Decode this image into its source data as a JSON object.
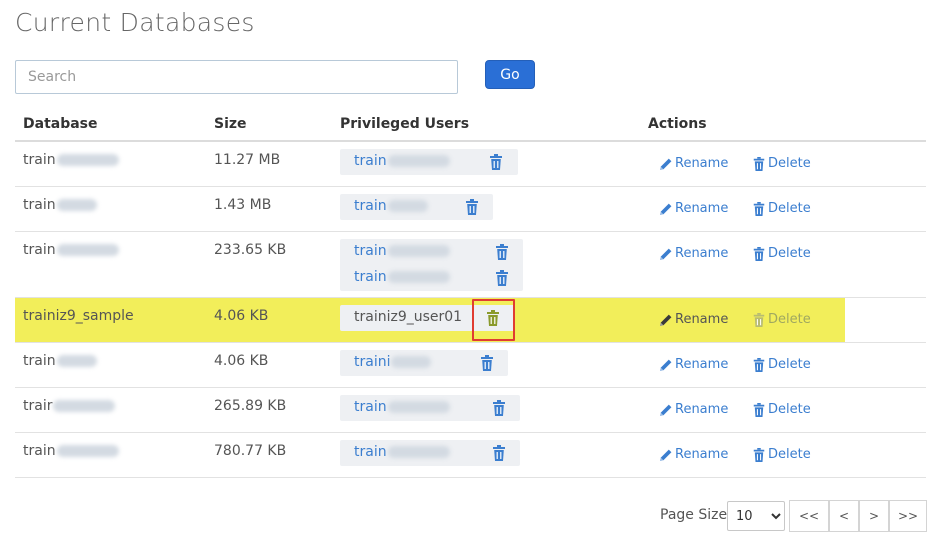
{
  "page": {
    "title": "Current Databases"
  },
  "search": {
    "placeholder": "Search",
    "value": "",
    "go_label": "Go"
  },
  "columns": {
    "database": "Database",
    "size": "Size",
    "users": "Privileged Users",
    "actions": "Actions"
  },
  "actions": {
    "rename_label": "Rename",
    "delete_label": "Delete"
  },
  "rows": [
    {
      "db_prefix": "train",
      "size": "11.27 MB",
      "users": [
        {
          "prefix": "train"
        }
      ]
    },
    {
      "db_prefix": "train",
      "size": "1.43 MB",
      "users": [
        {
          "prefix": "train"
        }
      ]
    },
    {
      "db_prefix": "train",
      "size": "233.65 KB",
      "users": [
        {
          "prefix": "train"
        },
        {
          "prefix": "train"
        }
      ]
    },
    {
      "db_name": "trainiz9_sample",
      "size": "4.06 KB",
      "highlighted": true,
      "delete_disabled": true,
      "users": [
        {
          "name": "trainiz9_user01"
        }
      ]
    },
    {
      "db_prefix": "train",
      "size": "4.06 KB",
      "users": [
        {
          "prefix": "traini"
        }
      ]
    },
    {
      "db_prefix": "trair",
      "size": "265.89 KB",
      "users": [
        {
          "prefix": "train"
        }
      ]
    },
    {
      "db_prefix": "train",
      "size": "780.77 KB",
      "users": [
        {
          "prefix": "train"
        }
      ]
    }
  ],
  "pagination": {
    "page_size_label": "Page Size",
    "page_size": "10",
    "first": "<<",
    "prev": "<",
    "next": ">",
    "last": ">>"
  },
  "colors": {
    "accent": "#2a6fd6",
    "link": "#3b7ecf",
    "highlight": "#f2ee5a",
    "callout": "#e03c31"
  }
}
